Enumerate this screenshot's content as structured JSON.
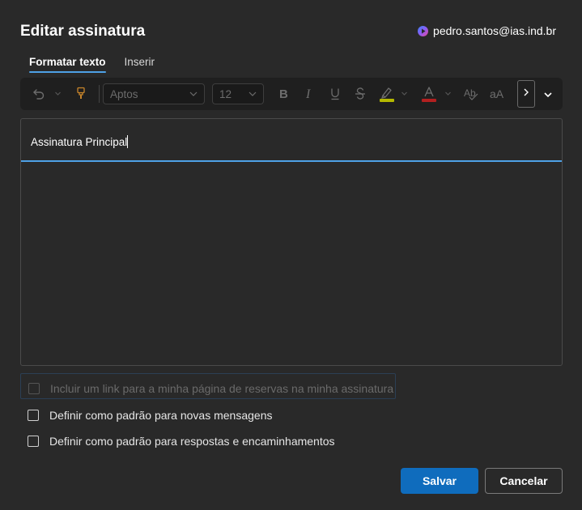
{
  "dialog": {
    "title": "Editar assinatura",
    "account_email": "pedro.santos@ias.ind.br"
  },
  "tabs": [
    {
      "label": "Formatar texto",
      "active": true
    },
    {
      "label": "Inserir",
      "active": false
    }
  ],
  "toolbar": {
    "font_name": "Aptos",
    "font_size": "12",
    "icons": [
      "undo-icon",
      "format-painter-icon",
      "bold-icon",
      "italic-icon",
      "underline-icon",
      "strikethrough-icon",
      "highlight-icon",
      "font-color-icon",
      "spell-check-icon",
      "change-case-icon",
      "more-options-icon",
      "expand-ribbon-icon"
    ]
  },
  "editor": {
    "signature_name": "Assinatura Principal"
  },
  "options": {
    "booking_link": "Incluir um link para a minha página de reservas na minha assinatura",
    "default_new": "Definir como padrão para novas mensagens",
    "default_replies": "Definir como padrão para respostas e encaminhamentos"
  },
  "buttons": {
    "save": "Salvar",
    "cancel": "Cancelar"
  },
  "colors": {
    "accent": "#4ea1e6",
    "primary_button": "#0f6cbd",
    "highlight_swatch": "#b5b800",
    "font_color_swatch": "#b32020"
  }
}
